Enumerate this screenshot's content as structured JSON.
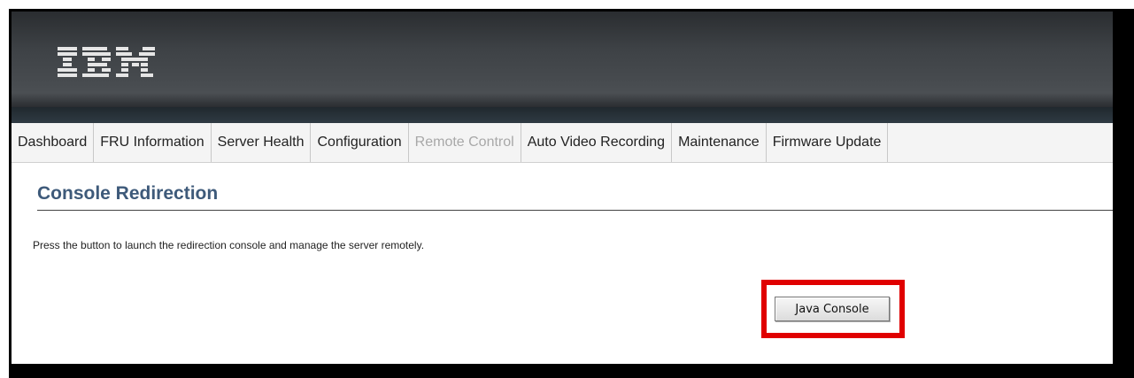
{
  "header": {
    "logo_text": "IBM",
    "logo_color": "#e8e8e8",
    "banner_color": "#3e4246"
  },
  "nav": {
    "items": [
      {
        "label": "Dashboard",
        "disabled": false
      },
      {
        "label": "FRU Information",
        "disabled": false
      },
      {
        "label": "Server Health",
        "disabled": false
      },
      {
        "label": "Configuration",
        "disabled": false
      },
      {
        "label": "Remote Control",
        "disabled": true
      },
      {
        "label": "Auto Video Recording",
        "disabled": false
      },
      {
        "label": "Maintenance",
        "disabled": false
      },
      {
        "label": "Firmware Update",
        "disabled": false
      }
    ]
  },
  "page": {
    "title": "Console Redirection",
    "title_color": "#3e5a7a",
    "description": "Press the button to launch the redirection console and manage the server remotely."
  },
  "actions": {
    "java_console_label": "Java Console",
    "highlight_color": "#e00000"
  }
}
